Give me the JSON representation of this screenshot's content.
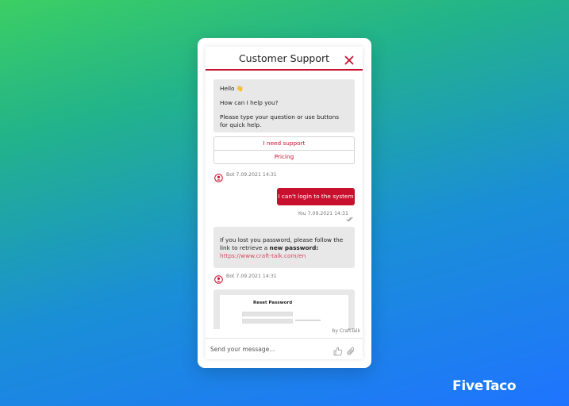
{
  "header": {
    "title": "Customer Support",
    "close_icon": "close-icon"
  },
  "messages": {
    "bot1": {
      "greeting": "Hello 👋",
      "line2": "How can I help you?",
      "line3": "Please type your question or use buttons for quick help."
    },
    "quick_buttons": [
      "I need support",
      "Pricing"
    ],
    "bot1_meta": "Bot 7.09.2021 14:31",
    "user1": {
      "text": "I can't login to the system",
      "meta": "You 7.09.2021 14:31"
    },
    "bot2": {
      "text_before": "If you lost you password, please follow the link to retrieve a ",
      "bold": "new password:",
      "link": "https://www.craft-talk.com/en"
    },
    "bot2_meta": "Bot 7.09.2021 14:31",
    "preview": {
      "title": "Reset Password"
    }
  },
  "footer": {
    "powered_by": "by CraftTalk",
    "input_placeholder": "Send your message...",
    "like_icon": "thumbs-up-icon",
    "attach_icon": "paperclip-icon"
  },
  "brand": {
    "logo": "FiveTaco"
  },
  "colors": {
    "accent": "#c8102e",
    "bot_bubble": "#e8e8e8"
  }
}
